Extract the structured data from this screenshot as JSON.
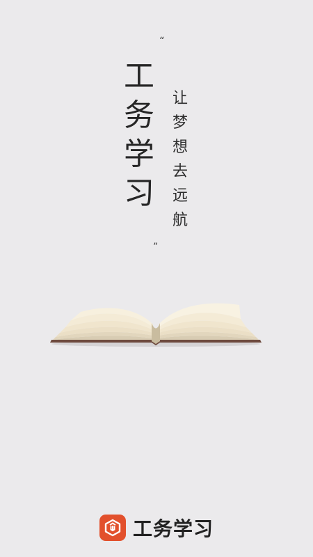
{
  "splash": {
    "quote_open": "“",
    "quote_close": "”",
    "title_chars": [
      "工",
      "务",
      "学",
      "习"
    ],
    "slogan_chars": [
      "让",
      "梦",
      "想",
      "去",
      "远",
      "航"
    ],
    "illustration": "open-book",
    "brand": {
      "logo_icon": "hexagon-logo-icon",
      "name": "工务学习",
      "accent_color": "#e2502c"
    }
  }
}
